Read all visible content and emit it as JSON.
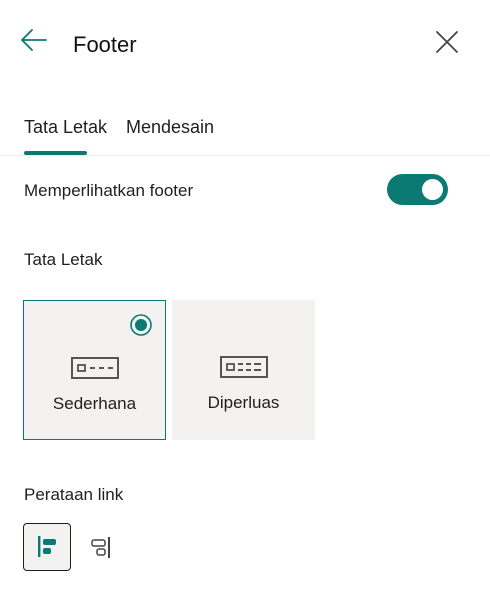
{
  "panel": {
    "title": "Footer",
    "back_icon": "arrow-left-icon",
    "close_icon": "close-icon"
  },
  "tabs": [
    {
      "label": "Tata Letak",
      "selected": true
    },
    {
      "label": "Mendesain",
      "selected": false
    }
  ],
  "show_footer": {
    "label": "Memperlihatkan footer",
    "enabled": true
  },
  "layout": {
    "section_label": "Tata Letak",
    "options": [
      {
        "label": "Sederhana",
        "icon": "footer-simple-icon",
        "selected": true
      },
      {
        "label": "Diperluas",
        "icon": "footer-extended-icon",
        "selected": false
      }
    ]
  },
  "link_alignment": {
    "section_label": "Perataan link",
    "options": [
      {
        "icon": "align-left-icon",
        "selected": true
      },
      {
        "icon": "align-right-icon",
        "selected": false
      }
    ]
  },
  "colors": {
    "accent": "#0a7a72",
    "card_background": "#f3f2f1",
    "text": "#1f1f1f"
  }
}
